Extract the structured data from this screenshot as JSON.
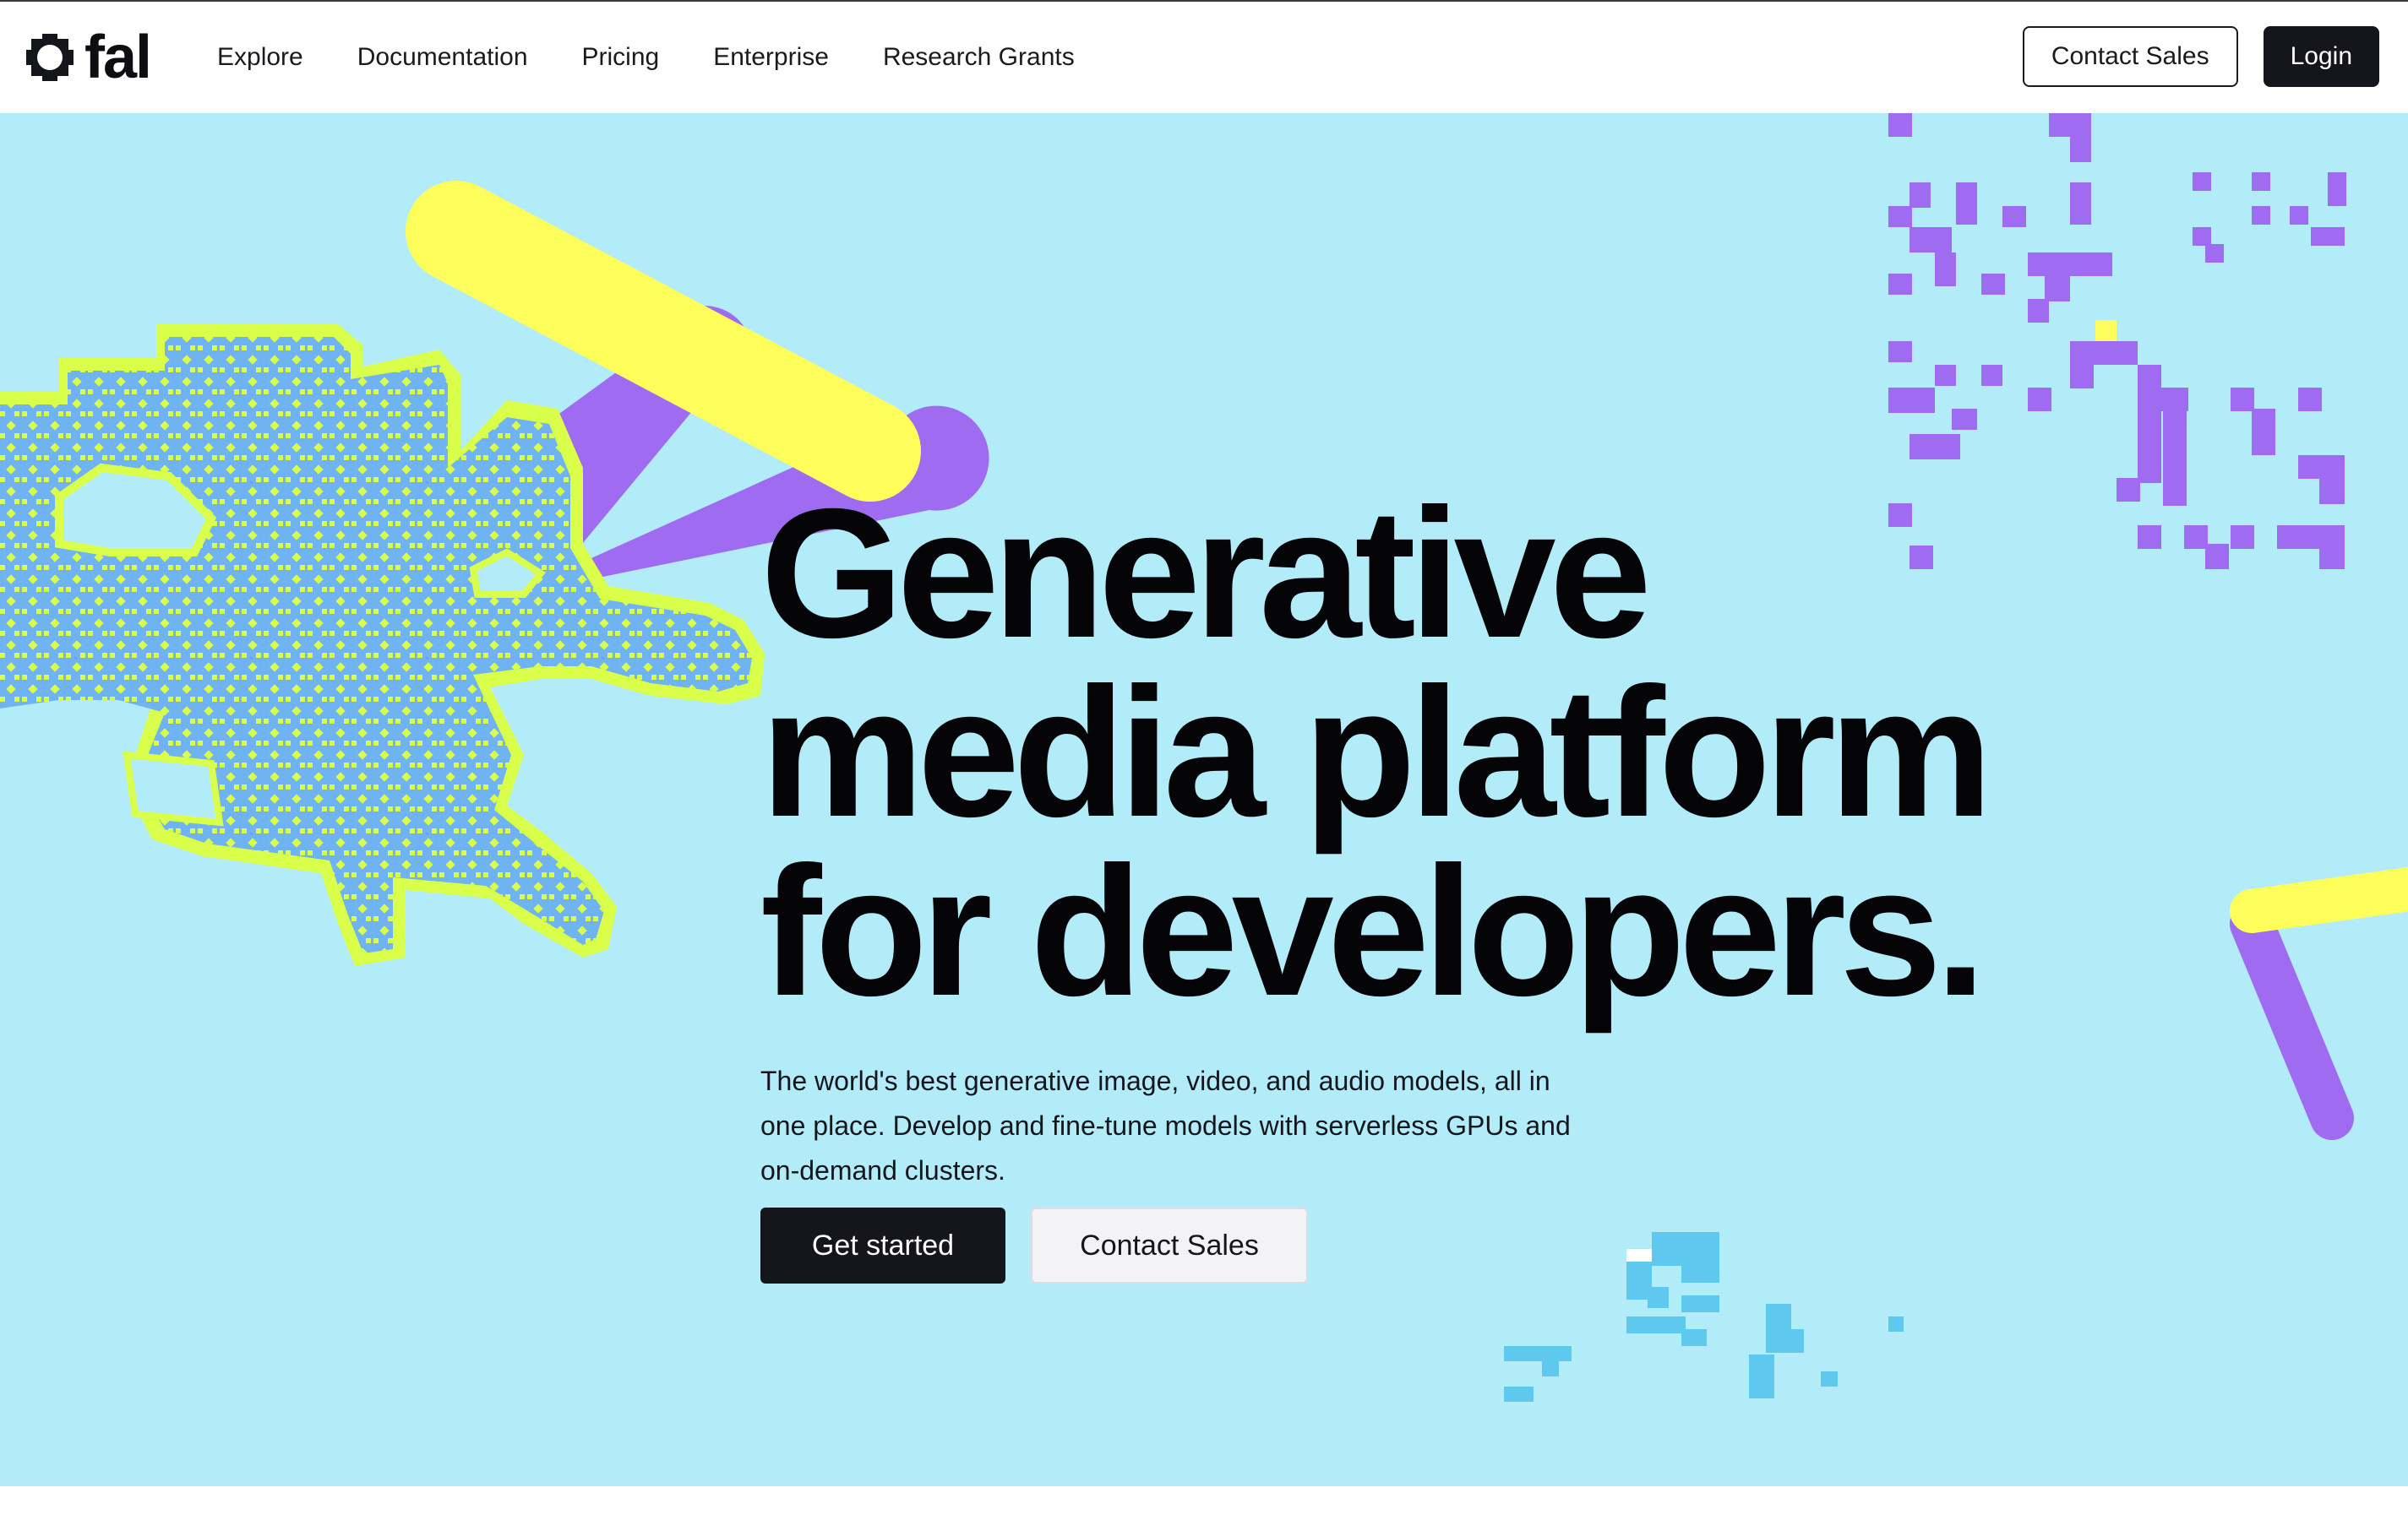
{
  "brand": {
    "name": "fal",
    "icon": "fal-logo-icon"
  },
  "nav": {
    "links": [
      "Explore",
      "Documentation",
      "Pricing",
      "Enterprise",
      "Research Grants"
    ],
    "contact_sales": "Contact Sales",
    "login": "Login"
  },
  "hero": {
    "headline": [
      "Generative",
      "media platform",
      "for developers."
    ],
    "subtext": "The world's best generative image, video, and audio models, all in one place. Develop and fine-tune models with serverless GPUs and on-demand clusters.",
    "primary_cta": "Get started",
    "secondary_cta": "Contact Sales"
  },
  "colors": {
    "hero_bg": "#b3ecf9",
    "purple": "#9f6bf0",
    "yellow": "#ffff5c",
    "lime": "#d9ff4a",
    "blue_blob": "#6fb3f2",
    "dark": "#15151c"
  }
}
